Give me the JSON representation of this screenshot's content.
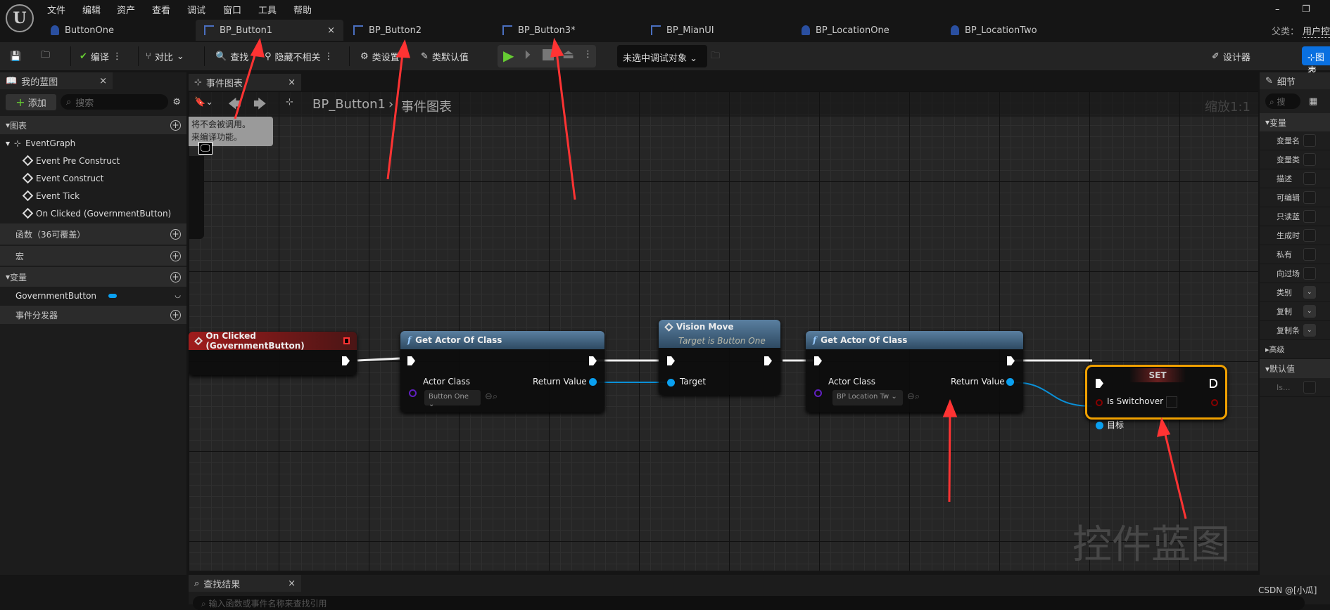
{
  "menu": [
    "文件",
    "编辑",
    "资产",
    "查看",
    "调试",
    "窗口",
    "工具",
    "帮助"
  ],
  "tabs": [
    {
      "label": "ButtonOne",
      "icon": "actor-icon"
    },
    {
      "label": "BP_Button1",
      "icon": "widget-blueprint-icon",
      "active": true,
      "close": "×"
    },
    {
      "label": "BP_Button2",
      "icon": "widget-blueprint-icon"
    },
    {
      "label": "BP_Button3*",
      "icon": "widget-blueprint-icon"
    },
    {
      "label": "BP_MianUI",
      "icon": "widget-blueprint-icon"
    },
    {
      "label": "BP_LocationOne",
      "icon": "actor-icon"
    },
    {
      "label": "BP_LocationTwo",
      "icon": "actor-icon"
    }
  ],
  "parent_class": {
    "label": "父类：",
    "value": "用户控"
  },
  "toolbar": {
    "compile": "编译",
    "diff": "对比",
    "find": "查找",
    "hide_unrelated": "隐藏不相关",
    "class_settings": "类设置",
    "class_defaults": "类默认值",
    "debug_target": "未选中调试对象",
    "designer": "设计器",
    "graph": "图表"
  },
  "my_blueprint": {
    "title": "我的蓝图",
    "add": "添加",
    "search_placeholder": "搜索",
    "graphs_label": "图表",
    "event_graph": "EventGraph",
    "events": [
      "Event Pre Construct",
      "Event Construct",
      "Event Tick",
      "On Clicked (GovernmentButton)"
    ],
    "functions_label": "函数（36可覆盖）",
    "macros_label": "宏",
    "variables_label": "变量",
    "variables": [
      {
        "name": "GovernmentButton",
        "type_color": "#0aa0f0"
      }
    ],
    "dispatchers_label": "事件分发器"
  },
  "graph": {
    "tab": "事件图表",
    "breadcrumb_bp": "BP_Button1",
    "breadcrumb_graph": "事件图表",
    "zoom": "缩放1:1",
    "comment_line1": "将不会被调用。",
    "comment_line2": "来编译功能。",
    "watermark": "控件蓝图"
  },
  "nodes": {
    "on_clicked": {
      "title": "On Clicked (GovernmentButton)",
      "color": "#8a1a1a"
    },
    "get_actor1": {
      "title": "Get Actor Of Class",
      "pin_in": "Actor Class",
      "class_value": "Button One",
      "pin_out": "Return Value"
    },
    "vision_move": {
      "title": "Vision Move",
      "subtitle": "Target is Button One",
      "pin_in": "Target"
    },
    "get_actor2": {
      "title": "Get Actor Of Class",
      "pin_in": "Actor Class",
      "class_value": "BP Location Tw",
      "pin_out": "Return Value"
    },
    "set": {
      "title": "SET",
      "pin_bool": "Is Switchover",
      "pin_target": "目标",
      "selected_color": "#f0a000"
    }
  },
  "details": {
    "title": "细节",
    "search_placeholder": "搜",
    "variables_label": "变量",
    "rows": [
      "变量名",
      "变量类",
      "描述",
      "可编辑",
      "只读蓝",
      "生成时",
      "私有",
      "向过场",
      "类别",
      "复制",
      "复制条"
    ],
    "advanced": "高级",
    "defaults": "默认值",
    "default_row": "Is..."
  },
  "find_results": {
    "title": "查找结果",
    "placeholder": "输入函数或事件名称来查找引用"
  },
  "credit": "CSDN @[小瓜]"
}
